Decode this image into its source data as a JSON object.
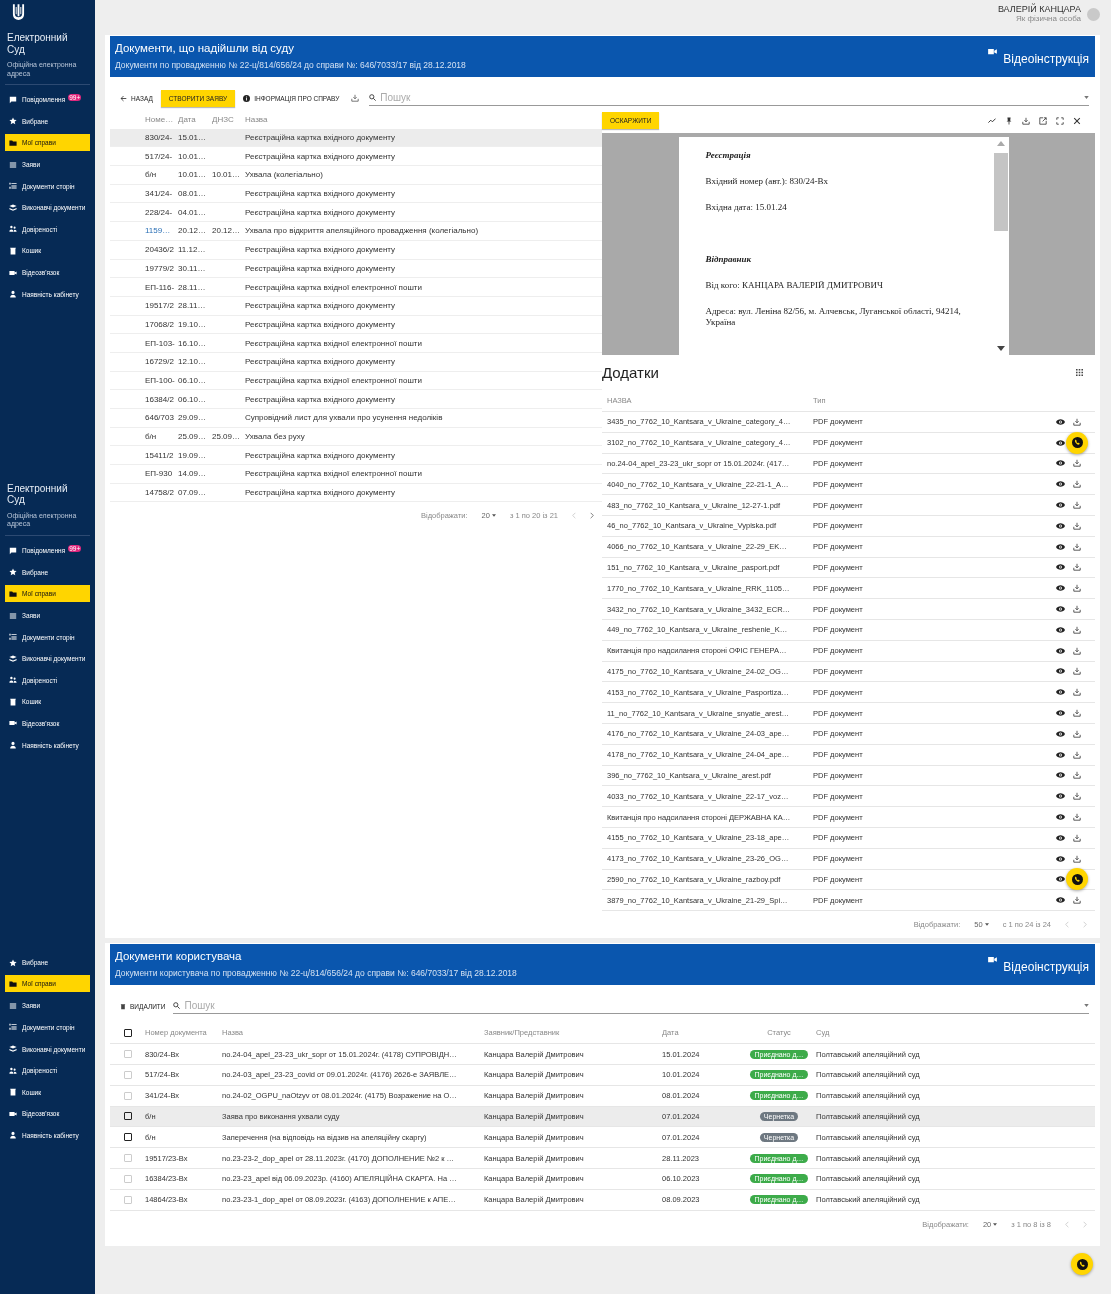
{
  "sidebars": [
    {
      "brand": {
        "title": "Електронний Суд",
        "subtitle": "Офіційна електронна адреса"
      },
      "emblem": true,
      "items": [
        {
          "kind": "messages",
          "label": "Повідомлення",
          "badge": "99+",
          "selected": false
        },
        {
          "kind": "star",
          "label": "Вибране",
          "selected": false
        },
        {
          "kind": "folder",
          "label": "Мої справи",
          "selected": true
        },
        {
          "kind": "list",
          "label": "Заяви",
          "selected": false
        },
        {
          "kind": "numbered",
          "label": "Документи сторін",
          "selected": false
        },
        {
          "kind": "stack",
          "label": "Виконавчі документи",
          "selected": false
        },
        {
          "kind": "people",
          "label": "Довіреності",
          "selected": false
        },
        {
          "kind": "trash",
          "label": "Кошик",
          "selected": false
        },
        {
          "kind": "video",
          "label": "Відеозв'язок",
          "selected": false
        },
        {
          "kind": "person",
          "label": "Наявність кабінету",
          "selected": false
        }
      ]
    },
    {
      "brand": {
        "title": "Електронний Суд",
        "subtitle": "Офіційна електронна адреса"
      },
      "emblem": false,
      "items": [
        {
          "kind": "messages",
          "label": "Повідомлення",
          "badge": "99+",
          "selected": false
        },
        {
          "kind": "star",
          "label": "Вибране",
          "selected": false
        },
        {
          "kind": "folder",
          "label": "Мої справи",
          "selected": true
        },
        {
          "kind": "list",
          "label": "Заяви",
          "selected": false
        },
        {
          "kind": "numbered",
          "label": "Документи сторін",
          "selected": false
        },
        {
          "kind": "stack",
          "label": "Виконавчі документи",
          "selected": false
        },
        {
          "kind": "people",
          "label": "Довіреності",
          "selected": false
        },
        {
          "kind": "trash",
          "label": "Кошик",
          "selected": false
        },
        {
          "kind": "video",
          "label": "Відеозв'язок",
          "selected": false
        },
        {
          "kind": "person",
          "label": "Наявність кабінету",
          "selected": false
        }
      ]
    },
    {
      "emblem": false,
      "items": [
        {
          "kind": "star",
          "label": "Вибране",
          "selected": false
        },
        {
          "kind": "folder",
          "label": "Мої справи",
          "selected": true
        },
        {
          "kind": "list",
          "label": "Заяви",
          "selected": false
        },
        {
          "kind": "numbered",
          "label": "Документи сторін",
          "selected": false
        },
        {
          "kind": "stack",
          "label": "Виконавчі документи",
          "selected": false
        },
        {
          "kind": "people",
          "label": "Довіреності",
          "selected": false
        },
        {
          "kind": "trash",
          "label": "Кошик",
          "selected": false
        },
        {
          "kind": "video",
          "label": "Відеозв'язок",
          "selected": false
        },
        {
          "kind": "person",
          "label": "Наявність кабінету",
          "selected": false
        }
      ]
    }
  ],
  "user": {
    "name": "ВАЛЕРІЙ КАНЦАРА",
    "role": "Як фізична особа"
  },
  "court_documents": {
    "title": "Документи, що надійшли від суду",
    "subtitle": "Документи по провадженню № 22-ц/814/656/24 до справи №: 646/7033/17 від 28.12.2018",
    "video_link": "Відеоінструкція",
    "toolbar": {
      "back": "НАЗАД",
      "create": "СТВОРИТИ ЗАЯВУ",
      "info": "ІНФОРМАЦІЯ ПРО СПРАВУ",
      "search_placeholder": "Пошук"
    },
    "table": {
      "columns": [
        "Номе…",
        "Дата",
        "ДНЗС",
        "Назва"
      ],
      "rows": [
        {
          "number": "830/24-",
          "date": "15.01…",
          "dnzs": "",
          "name": "Реєстраційна картка вхідного документу",
          "selected": true,
          "link": false
        },
        {
          "number": "517/24-",
          "date": "10.01…",
          "dnzs": "",
          "name": "Реєстраційна картка вхідного документу",
          "selected": false,
          "link": false
        },
        {
          "number": "б/н",
          "date": "10.01…",
          "dnzs": "10.01…",
          "name": "Ухвала (колегіально)",
          "selected": false,
          "link": false
        },
        {
          "number": "341/24-",
          "date": "08.01…",
          "dnzs": "",
          "name": "Реєстраційна картка вхідного документу",
          "selected": false,
          "link": false
        },
        {
          "number": "228/24-",
          "date": "04.01…",
          "dnzs": "",
          "name": "Реєстраційна картка вхідного документу",
          "selected": false,
          "link": false
        },
        {
          "number": "1159…",
          "date": "20.12…",
          "dnzs": "20.12…",
          "name": "Ухвала про відкриття апеляційного провадження (колегіально)",
          "selected": false,
          "link": true
        },
        {
          "number": "20436/2",
          "date": "11.12…",
          "dnzs": "",
          "name": "Реєстраційна картка вхідного документу",
          "selected": false,
          "link": false
        },
        {
          "number": "19779/2",
          "date": "30.11…",
          "dnzs": "",
          "name": "Реєстраційна картка вхідного документу",
          "selected": false,
          "link": false
        },
        {
          "number": "ЕП-116-",
          "date": "28.11…",
          "dnzs": "",
          "name": "Реєстраційна картка вхідної електронної пошти",
          "selected": false,
          "link": false
        },
        {
          "number": "19517/2",
          "date": "28.11…",
          "dnzs": "",
          "name": "Реєстраційна картка вхідного документу",
          "selected": false,
          "link": false
        },
        {
          "number": "17068/2",
          "date": "19.10…",
          "dnzs": "",
          "name": "Реєстраційна картка вхідного документу",
          "selected": false,
          "link": false
        },
        {
          "number": "ЕП-103-",
          "date": "16.10…",
          "dnzs": "",
          "name": "Реєстраційна картка вхідної електронної пошти",
          "selected": false,
          "link": false
        },
        {
          "number": "16729/2",
          "date": "12.10…",
          "dnzs": "",
          "name": "Реєстраційна картка вхідного документу",
          "selected": false,
          "link": false
        },
        {
          "number": "ЕП-100-",
          "date": "06.10…",
          "dnzs": "",
          "name": "Реєстраційна картка вхідної електронної пошти",
          "selected": false,
          "link": false
        },
        {
          "number": "16384/2",
          "date": "06.10…",
          "dnzs": "",
          "name": "Реєстраційна картка вхідного документу",
          "selected": false,
          "link": false
        },
        {
          "number": "646/703",
          "date": "29.09…",
          "dnzs": "",
          "name": "Супровідний лист для ухвали про усунення недоліків",
          "selected": false,
          "link": false
        },
        {
          "number": "б/н",
          "date": "25.09…",
          "dnzs": "25.09…",
          "name": "Ухвала без руху",
          "selected": false,
          "link": false
        },
        {
          "number": "15411/2",
          "date": "19.09…",
          "dnzs": "",
          "name": "Реєстраційна картка вхідного документу",
          "selected": false,
          "link": false
        },
        {
          "number": "ЕП-930",
          "date": "14.09…",
          "dnzs": "",
          "name": "Реєстраційна картка вхідної електронної пошти",
          "selected": false,
          "link": false
        },
        {
          "number": "14758/2",
          "date": "07.09…",
          "dnzs": "",
          "name": "Реєстраційна картка вхідного документу",
          "selected": false,
          "link": false
        }
      ],
      "pagination": {
        "label": "Відображати:",
        "page_size": "20",
        "range": "з 1 по 20 із 21"
      }
    },
    "viewer": {
      "appeal_button": "ОСКАРЖИТИ",
      "document": [
        {
          "kind": "heading",
          "text": "Реєстрація"
        },
        {
          "kind": "para",
          "text": "Вхідний номер (авт.): 830/24-Вх"
        },
        {
          "kind": "para",
          "text": "Вхідна дата: 15.01.24"
        },
        {
          "kind": "spacer"
        },
        {
          "kind": "heading",
          "text": "Відправник"
        },
        {
          "kind": "para",
          "text": "Від кого: КАНЦАРА ВАЛЕРІЙ ДМИТРОВИЧ"
        },
        {
          "kind": "para",
          "text": "Адреса: вул. Леніна 82/56, м. Алчевськ, Луганської області, 94214, Україна"
        }
      ]
    },
    "attachments": {
      "title": "Додатки",
      "columns": [
        "НАЗВА",
        "Тип"
      ],
      "rows": [
        {
          "name": "3435_no_7762_10_Kantsara_v_Ukraine_category_4…",
          "type": "PDF документ",
          "call_button": false
        },
        {
          "name": "3102_no_7762_10_Kantsara_v_Ukraine_category_4…",
          "type": "PDF документ",
          "call_button": true
        },
        {
          "name": "no.24-04_apel_23-23_ukr_sopr от 15.01.2024г. (417…",
          "type": "PDF документ",
          "call_button": false
        },
        {
          "name": "4040_no_7762_10_Kantsara_v_Ukraine_22-21-1_A…",
          "type": "PDF документ",
          "call_button": false
        },
        {
          "name": "483_no_7762_10_Kantsara_v_Ukraine_12-27-1.pdf",
          "type": "PDF документ",
          "call_button": false
        },
        {
          "name": "46_no_7762_10_Kantsara_v_Ukraine_Vypiska.pdf",
          "type": "PDF документ",
          "call_button": false
        },
        {
          "name": "4066_no_7762_10_Kantsara_v_Ukraine_22-29_EK…",
          "type": "PDF документ",
          "call_button": false
        },
        {
          "name": "151_no_7762_10_Kantsara_v_Ukraine_pasport.pdf",
          "type": "PDF документ",
          "call_button": false
        },
        {
          "name": "1770_no_7762_10_Kantsara_v_Ukraine_RRK_1105…",
          "type": "PDF документ",
          "call_button": false
        },
        {
          "name": "3432_no_7762_10_Kantsara_v_Ukraine_3432_ECR…",
          "type": "PDF документ",
          "call_button": false
        },
        {
          "name": "449_no_7762_10_Kantsara_v_Ukraine_reshenie_K…",
          "type": "PDF документ",
          "call_button": false
        },
        {
          "name": "Квитанція про надсилання стороні ОФІС ГЕНЕРА…",
          "type": "PDF документ",
          "call_button": false
        },
        {
          "name": "4175_no_7762_10_Kantsara_v_Ukraine_24-02_OG…",
          "type": "PDF документ",
          "call_button": false
        },
        {
          "name": "4153_no_7762_10_Kantsara_v_Ukraine_Pasportiza…",
          "type": "PDF документ",
          "call_button": false
        },
        {
          "name": "11_no_7762_10_Kantsara_v_Ukraine_snyatie_arest…",
          "type": "PDF документ",
          "call_button": false
        },
        {
          "name": "4176_no_7762_10_Kantsara_v_Ukraine_24-03_ape…",
          "type": "PDF документ",
          "call_button": false
        },
        {
          "name": "4178_no_7762_10_Kantsara_v_Ukraine_24-04_ape…",
          "type": "PDF документ",
          "call_button": false
        },
        {
          "name": "396_no_7762_10_Kantsara_v_Ukraine_arest.pdf",
          "type": "PDF документ",
          "call_button": false
        },
        {
          "name": "4033_no_7762_10_Kantsara_v_Ukraine_22-17_voz…",
          "type": "PDF документ",
          "call_button": false
        },
        {
          "name": "Квитанція про надсилання стороні ДЕРЖАВНА КА…",
          "type": "PDF документ",
          "call_button": false
        },
        {
          "name": "4155_no_7762_10_Kantsara_v_Ukraine_23-18_ape…",
          "type": "PDF документ",
          "call_button": false
        },
        {
          "name": "4173_no_7762_10_Kantsara_v_Ukraine_23-26_OG…",
          "type": "PDF документ",
          "call_button": false
        },
        {
          "name": "2590_no_7762_10_Kantsara_v_Ukraine_razboy.pdf",
          "type": "PDF документ",
          "call_button": true
        },
        {
          "name": "3879_no_7762_10_Kantsara_v_Ukraine_21-29_Spi…",
          "type": "PDF документ",
          "call_button": false
        }
      ],
      "pagination": {
        "label": "Відображати:",
        "page_size": "50",
        "range": "с 1 по 24 із 24"
      }
    }
  },
  "user_documents": {
    "title": "Документи користувача",
    "subtitle": "Документи користувача по провадженню № 22-ц/814/656/24 до справи №: 646/7033/17 від 28.12.2018",
    "video_link": "Відеоінструкція",
    "toolbar": {
      "delete": "ВИДАЛИТИ",
      "search_placeholder": "Пошук"
    },
    "select_all": {
      "checked": false
    },
    "columns": [
      "Номер документа",
      "Назва",
      "Заявник/Представник",
      "Дата",
      "Статус",
      "Суд"
    ],
    "rows": [
      {
        "number": "830/24-Вх",
        "name": "no.24-04_apel_23-23_ukr_sopr от 15.01.2024г. (4178) СУПРОВІДН…",
        "applicant": "Канцара Валерій Дмитрович",
        "date": "15.01.2024",
        "status": "Приєднано д…",
        "color": "#3dab4a",
        "court": "Полтавський апеляційний суд",
        "selected": false,
        "disabled": true
      },
      {
        "number": "517/24-Вх",
        "name": "no.24-03_apel_23-23_covid от 09.01.2024г. (4176) 2626-е ЗАЯВЛЕ…",
        "applicant": "Канцара Валерій Дмитрович",
        "date": "10.01.2024",
        "status": "Приєднано д…",
        "color": "#3dab4a",
        "court": "Полтавський апеляційний суд",
        "selected": false,
        "disabled": true
      },
      {
        "number": "341/24-Вх",
        "name": "no.24-02_OGPU_naOtzyv от 08.01.2024г. (4175) Возражение на О…",
        "applicant": "Канцара Валерій Дмитрович",
        "date": "08.01.2024",
        "status": "Приєднано д…",
        "color": "#3dab4a",
        "court": "Полтавський апеляційний суд",
        "selected": false,
        "disabled": true
      },
      {
        "number": "б/н",
        "name": "Заява про виконання ухвали суду",
        "applicant": "Канцара Валерій Дмитрович",
        "date": "07.01.2024",
        "status": "Чернетка",
        "color": "#6e7881",
        "court": "Полтавський апеляційний суд",
        "selected": true,
        "disabled": false
      },
      {
        "number": "б/н",
        "name": "Заперечення (на відповідь на відзив на апеляційну скаргу)",
        "applicant": "Канцара Валерій Дмитрович",
        "date": "07.01.2024",
        "status": "Чернетка",
        "color": "#6e7881",
        "court": "Полтавський апеляційний суд",
        "selected": false,
        "disabled": false
      },
      {
        "number": "19517/23-Вх",
        "name": "no.23-23-2_dop_apel от 28.11.2023г. (4170) ДОПОЛНЕНИЕ №2 к …",
        "applicant": "Канцара Валерій Дмитрович",
        "date": "28.11.2023",
        "status": "Приєднано д…",
        "color": "#3dab4a",
        "court": "Полтавський апеляційний суд",
        "selected": false,
        "disabled": true
      },
      {
        "number": "16384/23-Вх",
        "name": "no.23-23_apel від 06.09.2023р. (4160) АПЕЛЯЦІЙНА СКАРГА. На …",
        "applicant": "Канцара Валерій Дмитрович",
        "date": "06.10.2023",
        "status": "Приєднано д…",
        "color": "#3dab4a",
        "court": "Полтавський апеляційний суд",
        "selected": false,
        "disabled": true
      },
      {
        "number": "14864/23-Вх",
        "name": "no.23-23-1_dop_apel от 08.09.2023г. (4163) ДОПОЛНЕНИЕ к АПЕ…",
        "applicant": "Канцара Валерій Дмитрович",
        "date": "08.09.2023",
        "status": "Приєднано д…",
        "color": "#3dab4a",
        "court": "Полтавський апеляційний суд",
        "selected": false,
        "disabled": true
      }
    ],
    "pagination": {
      "label": "Відображати:",
      "page_size": "20",
      "range": "з 1 по 8 із 8"
    }
  },
  "floating_call_button": true
}
